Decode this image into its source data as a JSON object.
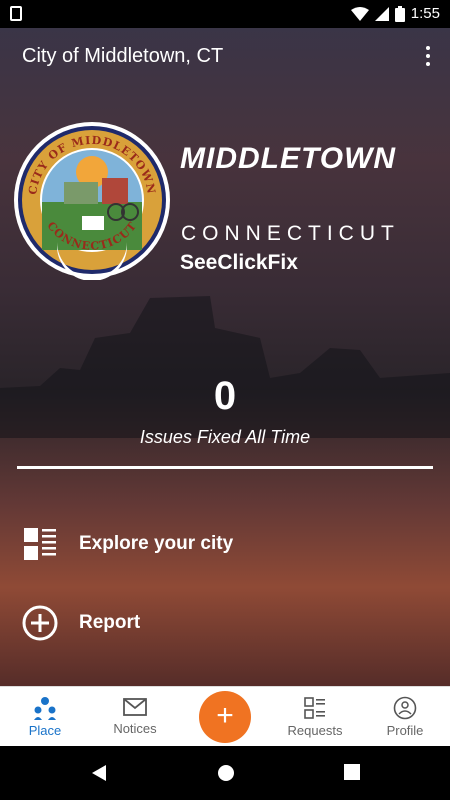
{
  "status_bar": {
    "time": "1:55"
  },
  "app_bar": {
    "title": "City of Middletown, CT"
  },
  "seal": {
    "top_text": "CITY OF MIDDLETOWN",
    "bottom_text": "CONNECTICUT"
  },
  "brand": {
    "city": "MIDDLETOWN",
    "state": "CONNECTICUT",
    "app": "SeeClickFix"
  },
  "stats": {
    "count": "0",
    "label": "Issues Fixed All Time"
  },
  "actions": [
    {
      "label": "Explore your city",
      "icon": "list-icon"
    },
    {
      "label": "Report",
      "icon": "add-circle-icon"
    }
  ],
  "bottom_nav": {
    "items": [
      {
        "label": "Place",
        "icon": "place-icon",
        "active": true
      },
      {
        "label": "Notices",
        "icon": "mail-icon",
        "active": false
      },
      {
        "label": "Requests",
        "icon": "requests-icon",
        "active": false
      },
      {
        "label": "Profile",
        "icon": "profile-icon",
        "active": false
      }
    ],
    "fab_label": "+"
  },
  "colors": {
    "accent": "#f07322",
    "active_tab": "#1a73c9"
  }
}
